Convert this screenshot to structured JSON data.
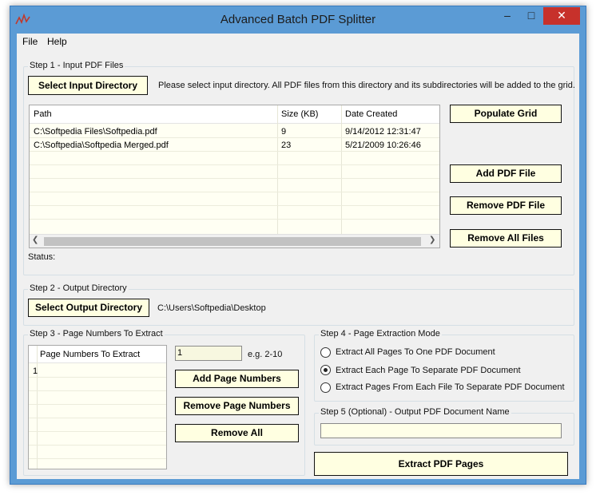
{
  "window": {
    "title": "Advanced Batch PDF Splitter"
  },
  "menu": [
    "File",
    "Help"
  ],
  "step1": {
    "title": "Step 1 - Input PDF Files",
    "select_btn": "Select Input Directory",
    "hint": "Please select input directory. All PDF files from this directory and its subdirectories will be added to the grid.",
    "columns": [
      "Path",
      "Size (KB)",
      "Date Created"
    ],
    "rows": [
      [
        "C:\\Softpedia Files\\Softpedia.pdf",
        "9",
        "9/14/2012 12:31:47"
      ],
      [
        "C:\\Softpedia\\Softpedia Merged.pdf",
        "23",
        "5/21/2009 10:26:46"
      ]
    ],
    "populate_btn": "Populate Grid",
    "add_btn": "Add PDF File",
    "remove_btn": "Remove PDF File",
    "remove_all_btn": "Remove All Files",
    "status_label": "Status:"
  },
  "step2": {
    "title": "Step 2 - Output Directory",
    "select_btn": "Select Output Directory",
    "path": "C:\\Users\\Softpedia\\Desktop"
  },
  "step3": {
    "title": "Step 3 - Page Numbers To Extract",
    "column": "Page Numbers To Extract",
    "rows": [
      "1"
    ],
    "input_value": "1",
    "example": "e.g. 2-10",
    "add_btn": "Add Page Numbers",
    "remove_btn": "Remove Page Numbers",
    "remove_all_btn": "Remove All"
  },
  "step4": {
    "title": "Step 4 - Page Extraction Mode",
    "options": [
      "Extract All Pages To One PDF Document",
      "Extract Each Page To Separate PDF Document",
      "Extract Pages From Each File To Separate PDF Document"
    ],
    "selected": 1
  },
  "step5": {
    "title": "Step 5 (Optional) - Output PDF Document Name",
    "value": ""
  },
  "extract_btn": "Extract PDF Pages",
  "colors": {
    "titlebar": "#5b9bd5",
    "button_bg": "#ffffe1",
    "grid_bg": "#fffff3",
    "close": "#c7312b"
  }
}
